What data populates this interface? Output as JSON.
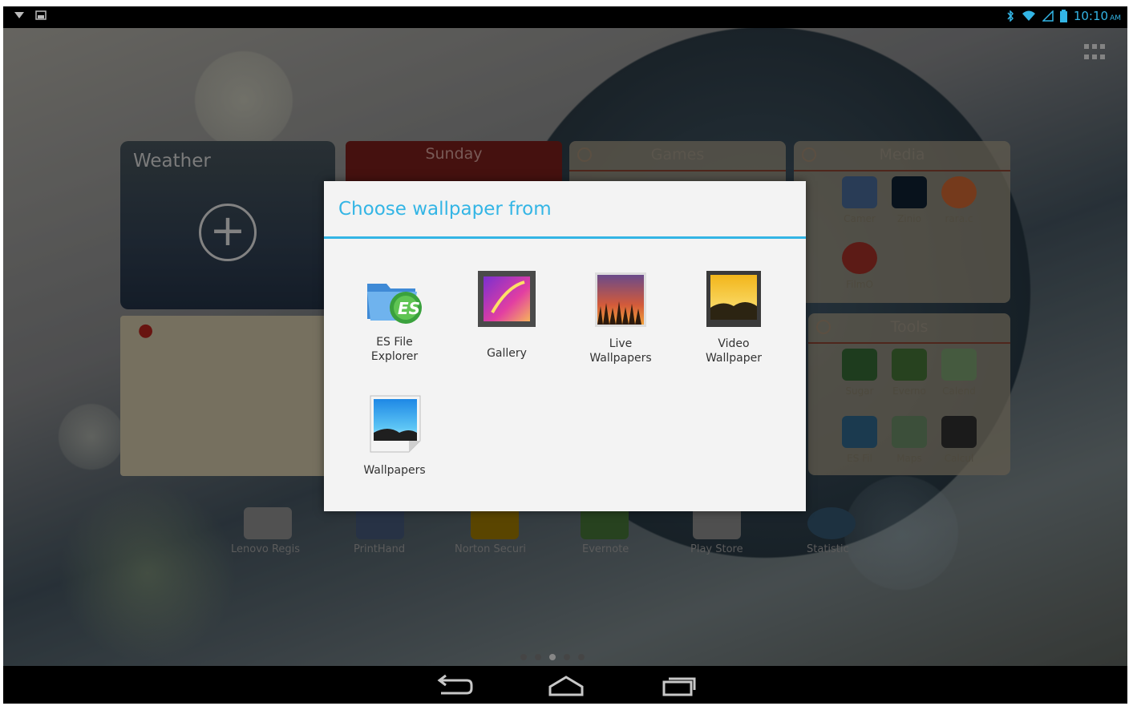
{
  "status_bar": {
    "time": "10:10",
    "ampm": "AM"
  },
  "launcher": {
    "weather_widget": {
      "title": "Weather"
    },
    "calendar_widget": {
      "day": "Sunday"
    },
    "folders": {
      "games": {
        "name": "Games"
      },
      "media": {
        "name": "Media",
        "apps": [
          "Camer",
          "Zinio",
          "rara.c",
          "FilmO"
        ]
      },
      "tools": {
        "name": "Tools",
        "apps": [
          "Sugar",
          "Everno",
          "Calend",
          "ES Fil",
          "Maps",
          "Calcul"
        ]
      }
    },
    "dock_apps": [
      "Lenovo Regis",
      "PrintHand",
      "Norton Securi",
      "Evernote",
      "Play Store",
      "Statistic"
    ]
  },
  "dialog": {
    "title": "Choose wallpaper from",
    "options": [
      {
        "label": "ES File Explorer",
        "label_lines": [
          "ES File",
          "Explorer"
        ],
        "icon": "es-file-explorer-icon"
      },
      {
        "label": "Gallery",
        "label_lines": [
          "Gallery"
        ],
        "icon": "gallery-icon"
      },
      {
        "label": "Live Wallpapers",
        "label_lines": [
          "Live",
          "Wallpapers"
        ],
        "icon": "live-wallpapers-icon"
      },
      {
        "label": "Video Wallpaper",
        "label_lines": [
          "Video",
          "Wallpaper"
        ],
        "icon": "video-wallpaper-icon"
      },
      {
        "label": "Wallpapers",
        "label_lines": [
          "Wallpapers"
        ],
        "icon": "wallpapers-icon"
      }
    ]
  },
  "colors": {
    "accent": "#33b5e5",
    "dialog_bg": "#f3f3f3",
    "status_bar": "#000000"
  }
}
